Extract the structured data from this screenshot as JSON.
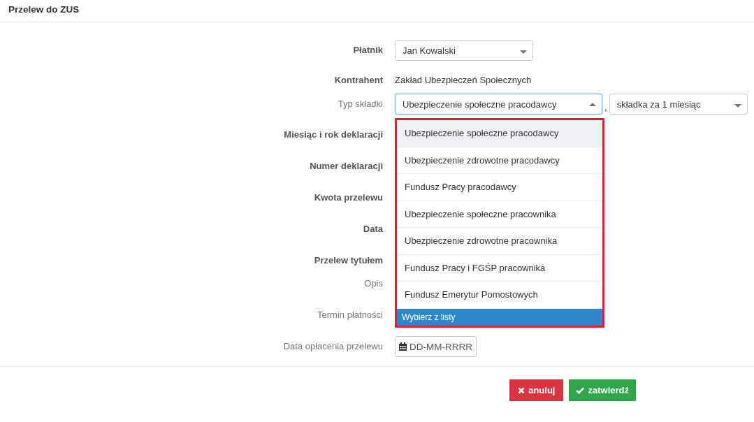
{
  "header": {
    "title": "Przelew do ZUS"
  },
  "rows": [
    {
      "label": "Płatnik",
      "required": true,
      "kind": "select",
      "value": "Jan Kowalski"
    },
    {
      "label": "Kontrahent",
      "required": true,
      "kind": "text",
      "value": "Zakład Ubezpieczeń Społecznych"
    },
    {
      "label": "Typ składki",
      "required": false,
      "kind": "double-select",
      "value": "Ubezpieczenie społeczne pracodawcy",
      "separator": ",",
      "second_value": "składka za 1 miesiąc"
    },
    {
      "label": "Miesiąc i rok deklaracji",
      "required": true,
      "kind": "covered"
    },
    {
      "label": "Numer deklaracji",
      "required": true,
      "kind": "covered"
    },
    {
      "label": "Kwota przelewu",
      "required": true,
      "kind": "covered"
    },
    {
      "label": "Data",
      "required": true,
      "kind": "covered"
    },
    {
      "label": "Przelew tytułem",
      "required": true,
      "kind": "covered"
    },
    {
      "label": "Opis",
      "required": false,
      "kind": "covered"
    },
    {
      "label": "Termin płatności",
      "required": false,
      "kind": "covered"
    },
    {
      "label": "Data opłacenia przelewu",
      "required": false,
      "kind": "date",
      "placeholder": "DD-MM-RRRR"
    }
  ],
  "dropdown": {
    "options": [
      {
        "label": "Ubezpieczenie społeczne pracodawcy",
        "selected": true
      },
      {
        "label": "Ubezpieczenie zdrowotne pracodawcy",
        "selected": false
      },
      {
        "label": "Fundusz Pracy pracodawcy",
        "selected": false
      },
      {
        "label": "Ubezpieczenie społeczne pracownika",
        "selected": false
      },
      {
        "label": "Ubezpieczenie zdrowotne pracownika",
        "selected": false
      },
      {
        "label": "Fundusz Pracy i FGŚP pracownika",
        "selected": false
      },
      {
        "label": "Fundusz Emerytur Pomostowych",
        "selected": false
      }
    ],
    "hint": "Wybierz z listy"
  },
  "buttons": [
    {
      "label": "anuluj",
      "kind": "cancel"
    },
    {
      "label": "zatwierdź",
      "kind": "confirm"
    }
  ]
}
